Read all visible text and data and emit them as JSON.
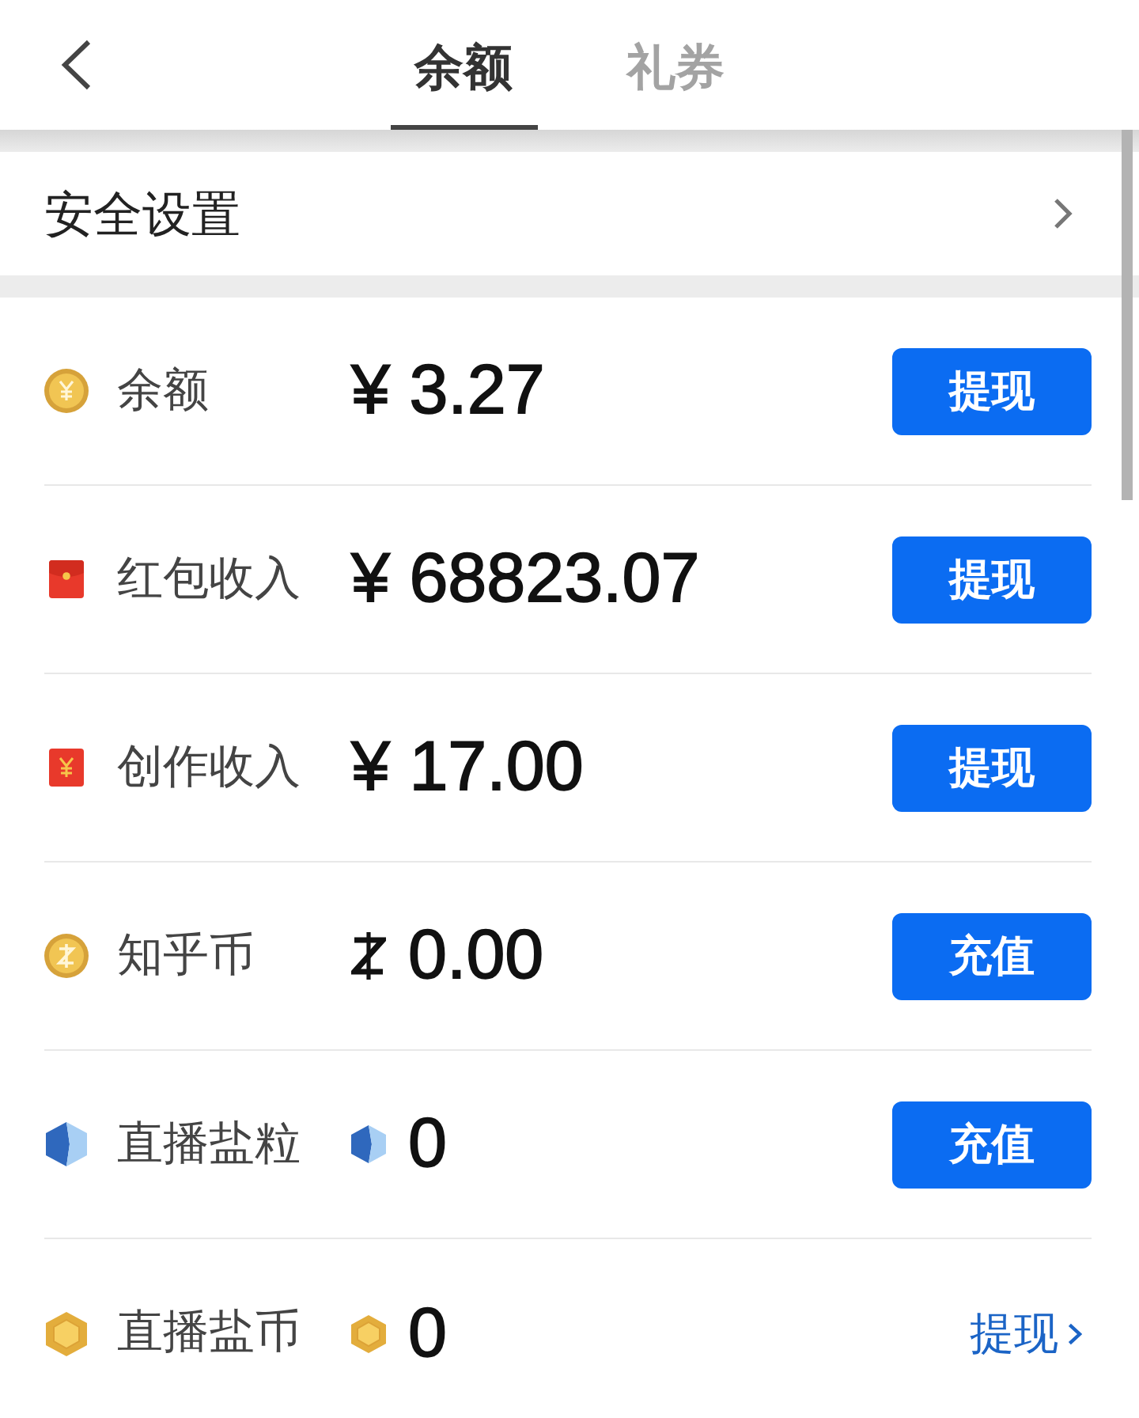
{
  "header": {
    "tabs": [
      {
        "label": "余额",
        "selected": true
      },
      {
        "label": "礼券",
        "selected": false
      }
    ]
  },
  "security": {
    "label": "安全设置"
  },
  "accounts": [
    {
      "kind": "coin",
      "label": "余额",
      "amount": "¥ 3.27",
      "action": {
        "kind": "button",
        "label": "提现"
      }
    },
    {
      "kind": "red-envelope",
      "label": "红包收入",
      "amount": "¥ 68823.07",
      "action": {
        "kind": "button",
        "label": "提现"
      }
    },
    {
      "kind": "envelope-yuan",
      "label": "创作收入",
      "amount": "¥ 17.00",
      "action": {
        "kind": "button",
        "label": "提现"
      }
    },
    {
      "kind": "zhihu-coin",
      "label": "知乎币",
      "amount": "0.00",
      "action": {
        "kind": "button",
        "label": "充值"
      }
    },
    {
      "kind": "salt-grain",
      "label": "直播盐粒",
      "amount": "0",
      "action": {
        "kind": "button",
        "label": "充值"
      }
    },
    {
      "kind": "salt-coin",
      "label": "直播盐币",
      "amount": "0",
      "action": {
        "kind": "link",
        "label": "提现"
      }
    }
  ]
}
